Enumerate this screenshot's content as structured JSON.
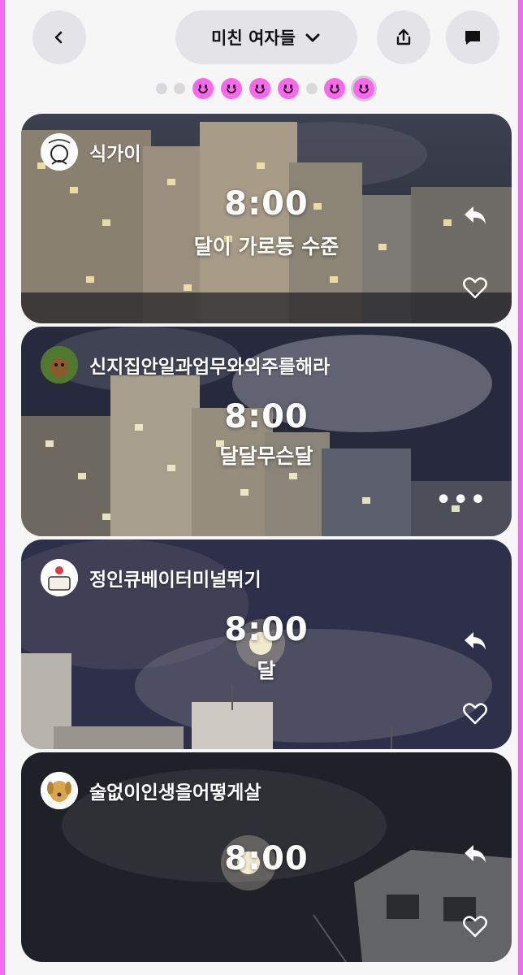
{
  "header": {
    "title": "미친 여자들",
    "back_icon": "chevron-left-icon",
    "share_icon": "share-icon",
    "chat_icon": "chat-bubble-icon"
  },
  "pagination": {
    "items": [
      "dot",
      "dot",
      "smiley",
      "smiley",
      "smiley",
      "smiley",
      "dot",
      "smiley",
      "smiley-active"
    ],
    "accent": "#ff66ee"
  },
  "posts": [
    {
      "username": "식가이",
      "time": "8:00",
      "caption": "달이 가로등 수준",
      "action_icon": "reply-icon",
      "like_icon": "heart-icon"
    },
    {
      "username": "신지집안일과업무와외주를해라",
      "time": "8:00",
      "caption": "달달무슨달",
      "action_icon": "more-icon",
      "more_label": "•••"
    },
    {
      "username": "정인큐베이터미널뛰기",
      "time": "8:00",
      "caption": "달",
      "action_icon": "reply-icon",
      "like_icon": "heart-icon"
    },
    {
      "username": "술없이인생을어떻게살",
      "time": "8:00",
      "caption": "",
      "action_icon": "reply-icon",
      "like_icon": "heart-icon"
    }
  ],
  "colors": {
    "frame": "#f36bf0",
    "button_bg": "#e4e4e8"
  }
}
